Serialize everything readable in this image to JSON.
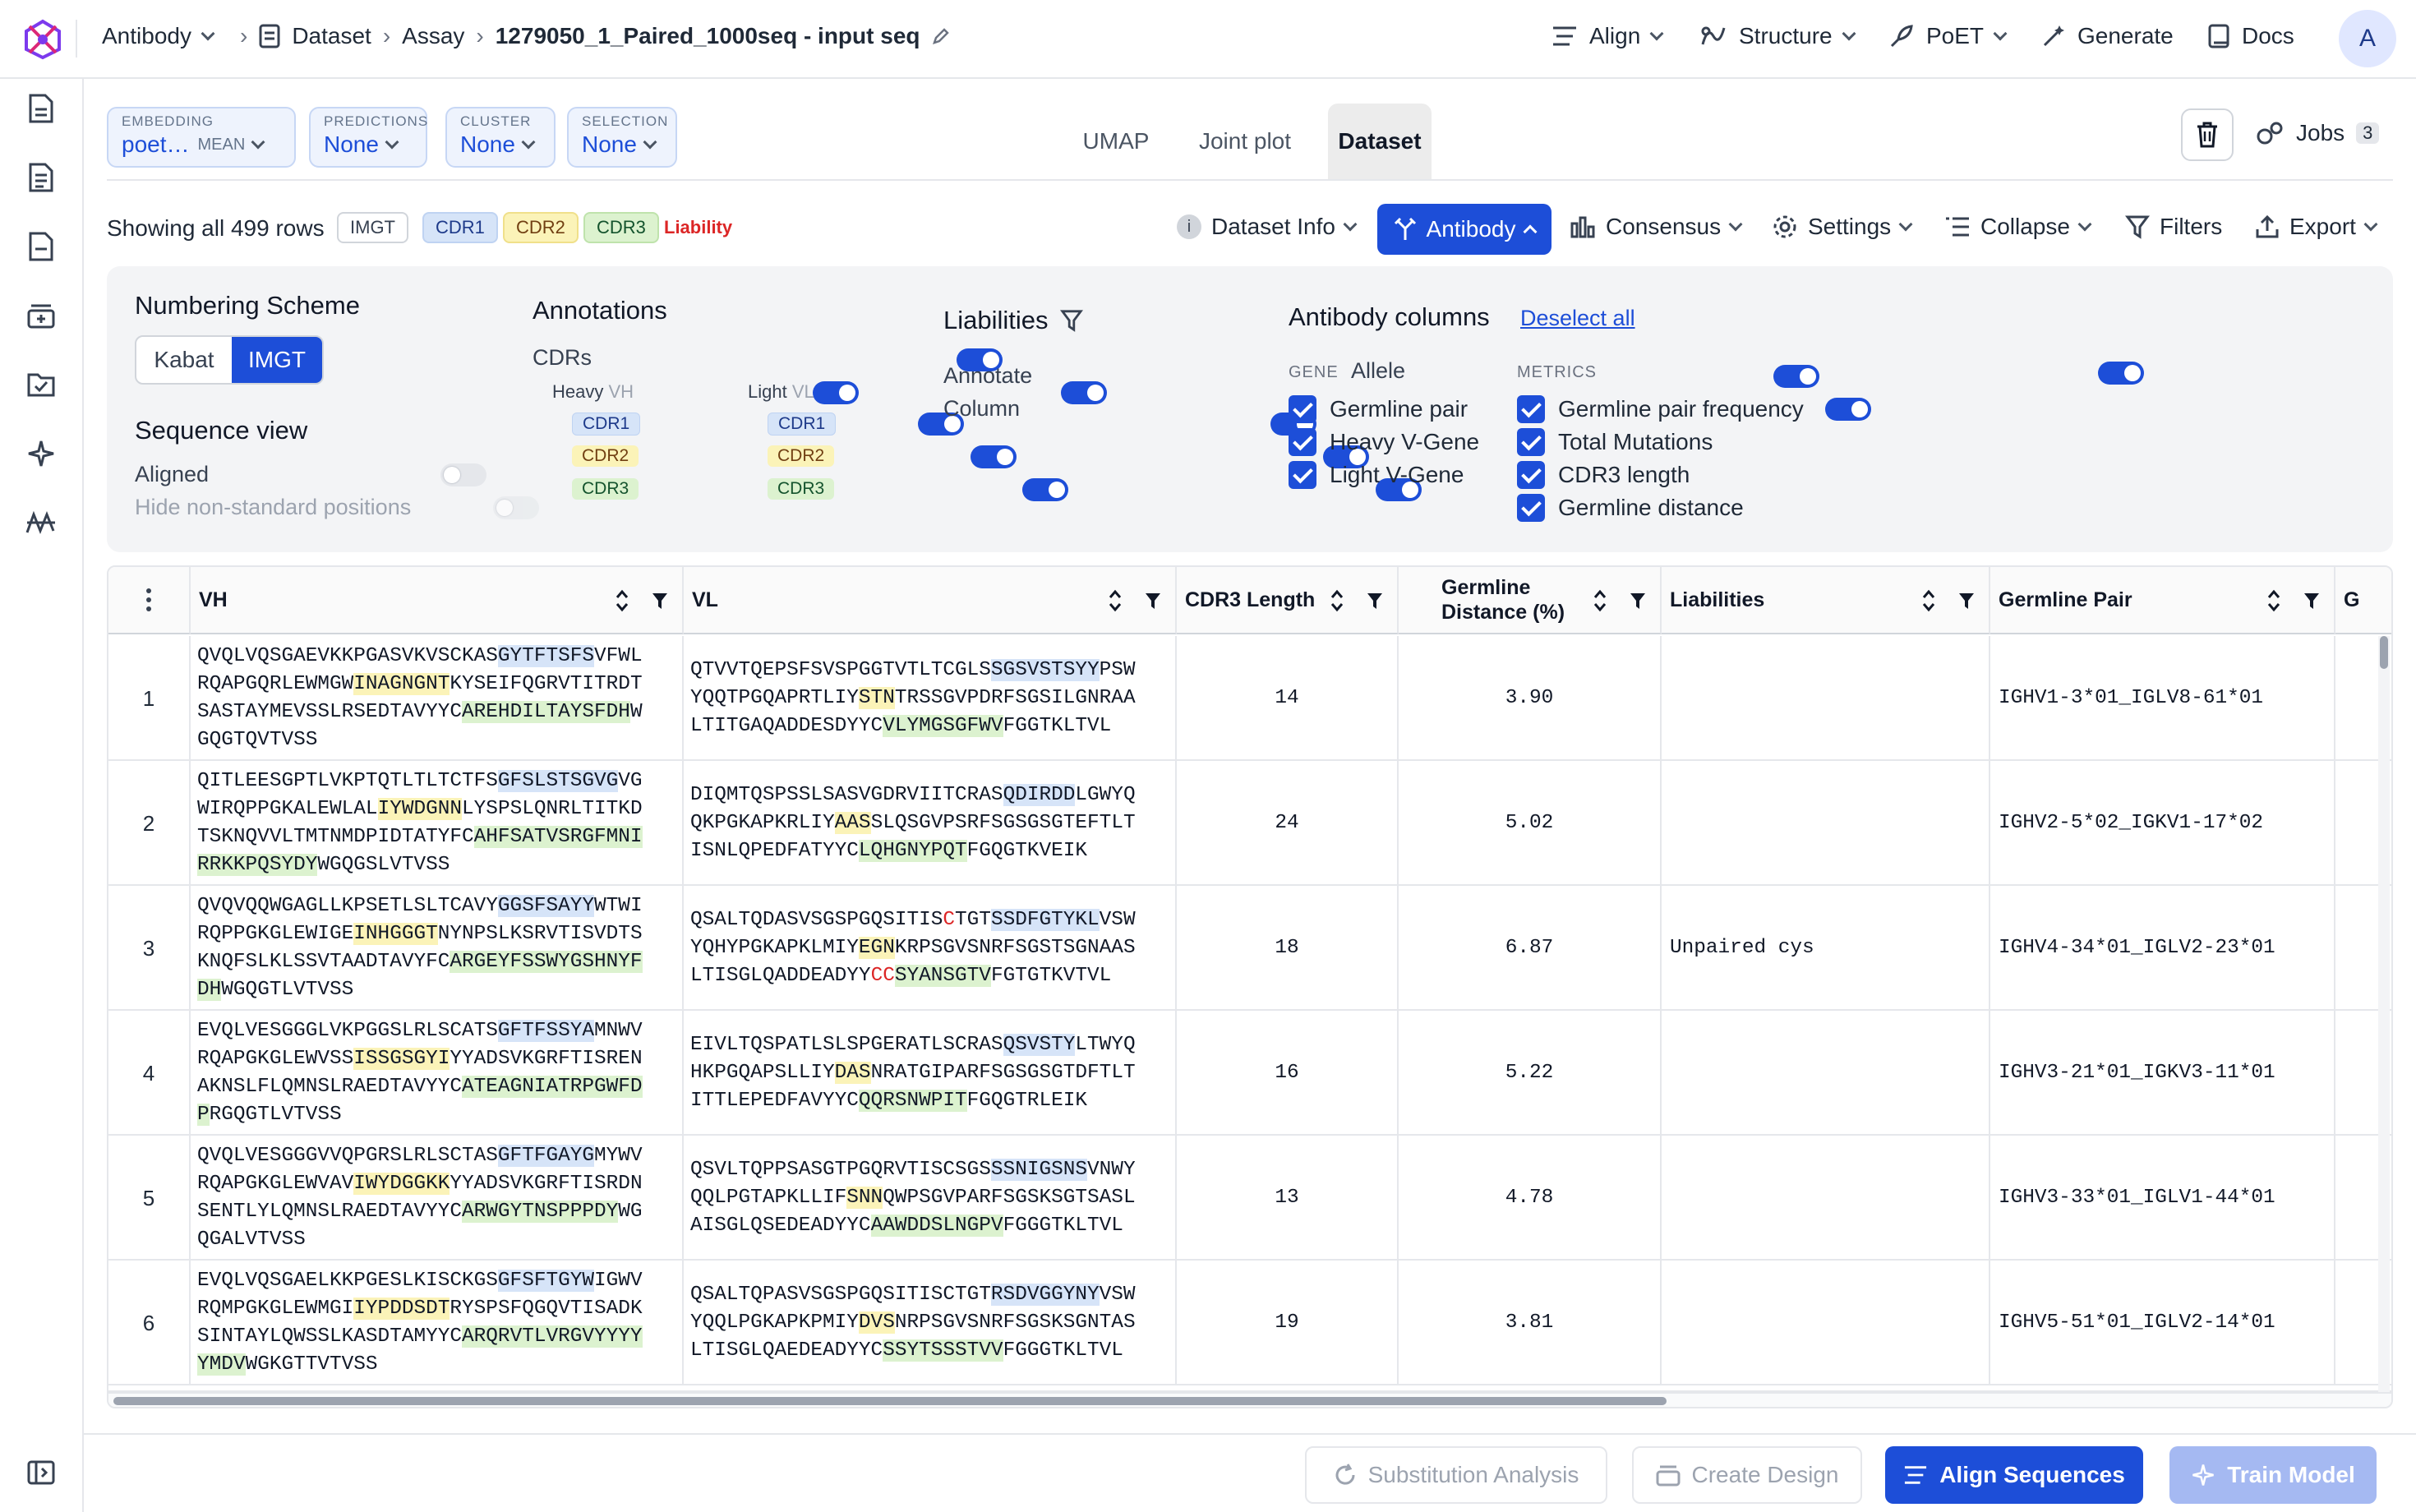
{
  "topbar": {
    "project": "Antibody",
    "crumbs": [
      "Dataset",
      "Assay"
    ],
    "current": "1279050_1_Paired_1000seq - input seq",
    "menu": [
      "Align",
      "Structure",
      "PoET",
      "Generate",
      "Docs"
    ],
    "avatar": "A"
  },
  "controls": {
    "embedding": {
      "label": "EMBEDDING",
      "value": "poet…",
      "suffix": "MEAN"
    },
    "predictions": {
      "label": "PREDICTIONS",
      "value": "None"
    },
    "cluster": {
      "label": "CLUSTER",
      "value": "None"
    },
    "selection": {
      "label": "SELECTION",
      "value": "None"
    },
    "tabs": [
      "UMAP",
      "Joint plot",
      "Dataset"
    ],
    "active_tab": "Dataset",
    "jobs_label": "Jobs",
    "jobs_count": "3"
  },
  "toolbar": {
    "showing": "Showing all 499 rows",
    "tags": {
      "scheme": "IMGT",
      "cdr1": "CDR1",
      "cdr2": "CDR2",
      "cdr3": "CDR3",
      "liability": "Liability"
    },
    "dataset_info": "Dataset Info",
    "antibody": "Antibody",
    "consensus": "Consensus",
    "settings": "Settings",
    "collapse": "Collapse",
    "filters": "Filters",
    "export": "Export"
  },
  "panel": {
    "numbering_title": "Numbering Scheme",
    "numbering_options": [
      "Kabat",
      "IMGT"
    ],
    "numbering_selected": "IMGT",
    "seqview_title": "Sequence view",
    "aligned_label": "Aligned",
    "hide_label": "Hide non-standard positions",
    "annotations_title": "Annotations",
    "cdrs_label": "CDRs",
    "heavy_label": "Heavy",
    "heavy_sub": "VH",
    "light_label": "Light",
    "light_sub": "VL",
    "cdr_names": [
      "CDR1",
      "CDR2",
      "CDR3"
    ],
    "liabilities_title": "Liabilities",
    "annotate_label": "Annotate",
    "column_label": "Column",
    "abcols_title": "Antibody columns",
    "deselect_all": "Deselect all",
    "gene_label": "GENE",
    "allele_label": "Allele",
    "gene_items": [
      "Germline pair",
      "Heavy V-Gene",
      "Light V-Gene"
    ],
    "metrics_label": "METRICS",
    "metric_items": [
      "Germline pair frequency",
      "Total Mutations",
      "CDR3 length",
      "Germline distance"
    ]
  },
  "table": {
    "columns": {
      "vh": "VH",
      "vl": "VL",
      "cdr3": "CDR3 Length",
      "gdist_1": "Germline",
      "gdist_2": "Distance (%)",
      "liab": "Liabilities",
      "gpair": "Germline Pair",
      "next": "G"
    },
    "rows": [
      {
        "idx": "1",
        "vh": [
          [
            "QVQLVQSGAEVKKPGASVKVSCKAS",
            ""
          ],
          [
            "GYTFTSFS",
            "c1"
          ],
          [
            "VFWL\nRQAPGQRLEWMGW",
            ""
          ],
          [
            "INAGNGNT",
            "c2"
          ],
          [
            "KYSEIFQGRVTITRDT\nSASTAYMEVSSLRSEDTAVYYC",
            ""
          ],
          [
            "AREHDILTAYSFDH",
            "c3"
          ],
          [
            "W\nGQGTQVTVSS",
            ""
          ]
        ],
        "vl": [
          [
            "QTVVTQEPSFSVSPGGTVTLTCGLS",
            ""
          ],
          [
            "SGSVSTSYY",
            "c1"
          ],
          [
            "PSW\nYQQTPGQAPRTLIY",
            ""
          ],
          [
            "STN",
            "c2"
          ],
          [
            "TRSSGVPDRFSGSILGNRAA\nLTITGAQADDESDYYC",
            ""
          ],
          [
            "VLYMGSGFWV",
            "c3"
          ],
          [
            "FGGTKLTVL",
            ""
          ]
        ],
        "cdr3": "14",
        "gdist": "3.90",
        "liab": "",
        "gpair": "IGHV1-3*01_IGLV8-61*01"
      },
      {
        "idx": "2",
        "vh": [
          [
            "QITLEESGPTLVKPTQTLTLTCTFS",
            ""
          ],
          [
            "GFSLSTSGVG",
            "c1"
          ],
          [
            "VG\nWIRQPPGKALEWLAL",
            ""
          ],
          [
            "IYWDGNN",
            "c2"
          ],
          [
            "LYSPSLQNRLTITKD\nTSKNQVVLTMTNMDPIDTATYFC",
            ""
          ],
          [
            "AHFSATVSRGFMNI\nRRKKPQSYDY",
            "c3"
          ],
          [
            "WGQGSLVTVSS",
            ""
          ]
        ],
        "vl": [
          [
            "DIQMTQSPSSLSASVGDRVIITCRAS",
            ""
          ],
          [
            "QDIRDD",
            "c1"
          ],
          [
            "LGWYQ\nQKPGKAPKRLIY",
            ""
          ],
          [
            "AAS",
            "c2"
          ],
          [
            "SLQSGVPSRFSGSGSGTEFTLT\nISNLQPEDFATYYC",
            ""
          ],
          [
            "LQHGNYPQT",
            "c3"
          ],
          [
            "FGQGTKVEIK",
            ""
          ]
        ],
        "cdr3": "24",
        "gdist": "5.02",
        "liab": "",
        "gpair": "IGHV2-5*02_IGKV1-17*02"
      },
      {
        "idx": "3",
        "vh": [
          [
            "QVQVQQWGAGLLKPSETLSLTCAVY",
            ""
          ],
          [
            "GGSFSAYY",
            "c1"
          ],
          [
            "WTWI\nRQPPGKGLEWIGE",
            ""
          ],
          [
            "INHGGGT",
            "c2"
          ],
          [
            "NYNPSLKSRVTISVDTS\nKNQFSLKLSSVTAADTAVYFC",
            ""
          ],
          [
            "ARGEYFSSWYGSHNYF\nDH",
            "c3"
          ],
          [
            "WGQGTLVTVSS",
            ""
          ]
        ],
        "vl": [
          [
            "QSALTQDASVSGSPGQSITIS",
            ""
          ],
          [
            "C",
            "lb"
          ],
          [
            "TGT",
            ""
          ],
          [
            "SSDFGTYKL",
            "c1"
          ],
          [
            "VSW\nYQHYPGKAPKLMIY",
            ""
          ],
          [
            "EGN",
            "c2"
          ],
          [
            "KRPSGVSNRFSGSTSGNAAS\nLTISGLQADDEADYY",
            ""
          ],
          [
            "CC",
            "lb"
          ],
          [
            "SYANSGTV",
            "c3"
          ],
          [
            "FGTGTKVTVL",
            ""
          ]
        ],
        "cdr3": "18",
        "gdist": "6.87",
        "liab": "Unpaired cys",
        "gpair": "IGHV4-34*01_IGLV2-23*01"
      },
      {
        "idx": "4",
        "vh": [
          [
            "EVQLVESGGGLVKPGGSLRLSCATS",
            ""
          ],
          [
            "GFTFSSYA",
            "c1"
          ],
          [
            "MNWV\nRQAPGKGLEWVSS",
            ""
          ],
          [
            "ISSGSGYI",
            "c2"
          ],
          [
            "YYADSVKGRFTISREN\nAKNSLFLQMNSLRAEDTAVYYC",
            ""
          ],
          [
            "ATEAGNIATRPGWFD\nP",
            "c3"
          ],
          [
            "RGQGTLVTVSS",
            ""
          ]
        ],
        "vl": [
          [
            "EIVLTQSPATLSLSPGERATLSCRAS",
            ""
          ],
          [
            "QSVSTY",
            "c1"
          ],
          [
            "LTWYQ\nHKPGQAPSLLIY",
            ""
          ],
          [
            "DAS",
            "c2"
          ],
          [
            "NRATGIPARFSGSGSGTDFTLT\nITTLEPEDFAVYYC",
            ""
          ],
          [
            "QQRSNWPIT",
            "c3"
          ],
          [
            "FGQGTRLEIK",
            ""
          ]
        ],
        "cdr3": "16",
        "gdist": "5.22",
        "liab": "",
        "gpair": "IGHV3-21*01_IGKV3-11*01"
      },
      {
        "idx": "5",
        "vh": [
          [
            "QVQLVESGGGVVQPGRSLRLSCTAS",
            ""
          ],
          [
            "GFTFGAYG",
            "c1"
          ],
          [
            "MYWV\nRQAPGKGLEWVAV",
            ""
          ],
          [
            "IWYDGGKK",
            "c2"
          ],
          [
            "YYADSVKGRFTISRDN\nSENTLYLQMNSLRAEDTAVYYC",
            ""
          ],
          [
            "ARWGYTNSPPPDY",
            "c3"
          ],
          [
            "WG\nQGALVTVSS",
            ""
          ]
        ],
        "vl": [
          [
            "QSVLTQPPSASGTPGQRVTISCSGS",
            ""
          ],
          [
            "SSNIGSNS",
            "c1"
          ],
          [
            "VNWY\nQQLPGTAPKLLIF",
            ""
          ],
          [
            "SNN",
            "c2"
          ],
          [
            "QWPSGVPARFSGSKSGTSASL\nAISGLQSEDEADYYC",
            ""
          ],
          [
            "AAWDDSLNGPV",
            "c3"
          ],
          [
            "FGGGTKLTVL",
            ""
          ]
        ],
        "cdr3": "13",
        "gdist": "4.78",
        "liab": "",
        "gpair": "IGHV3-33*01_IGLV1-44*01"
      },
      {
        "idx": "6",
        "vh": [
          [
            "EVQLVQSGAELKKPGESLKISCKGS",
            ""
          ],
          [
            "GFSFTGYW",
            "c1"
          ],
          [
            "IGWV\nRQMPGKGLEWMGI",
            ""
          ],
          [
            "IYPDDSDT",
            "c2"
          ],
          [
            "RYSPSFQGQVTISADK\nSINTAYLQWSSLKASDTAMYYC",
            ""
          ],
          [
            "ARQRVTLVRGVYYYY\nYMDV",
            "c3"
          ],
          [
            "WGKGTTVTVSS",
            ""
          ]
        ],
        "vl": [
          [
            "QSALTQPASVSGSPGQSITISCTGT",
            ""
          ],
          [
            "RSDVGGYNY",
            "c1"
          ],
          [
            "VSW\nYQQLPGKAPKPMIY",
            ""
          ],
          [
            "DVS",
            "c2"
          ],
          [
            "NRPSGVSNRFSGSKSGNTAS\nLTISGLQAEDEADYYC",
            ""
          ],
          [
            "SSYTSSSTVV",
            "c3"
          ],
          [
            "FGGGTKLTVL",
            ""
          ]
        ],
        "cdr3": "19",
        "gdist": "3.81",
        "liab": "",
        "gpair": "IGHV5-51*01_IGLV2-14*01"
      }
    ]
  },
  "actions": {
    "substitution": "Substitution Analysis",
    "create_design": "Create Design",
    "align_sequences": "Align Sequences",
    "train_model": "Train Model"
  },
  "colors": {
    "accent": "#1d4ed8",
    "cdr1": "#d6e4f8",
    "cdr2": "#fbf3b8",
    "cdr3": "#dcf2cf",
    "liability": "#dc2626"
  }
}
